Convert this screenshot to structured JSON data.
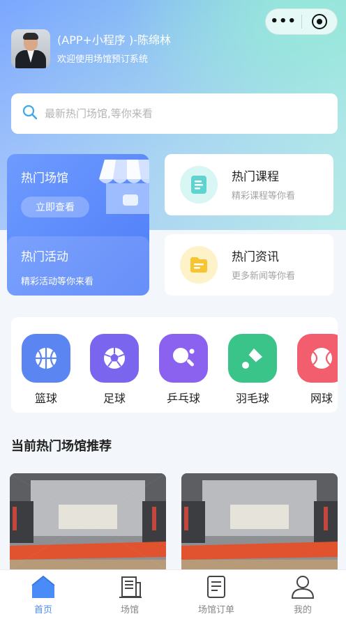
{
  "capsule": {
    "more_icon": "more-dots-icon",
    "close_icon": "target-circle-icon"
  },
  "profile": {
    "name": "(APP+小程序 )-陈绵林",
    "subtitle": "欢迎使用场馆预订系统"
  },
  "search": {
    "placeholder": "最新热门场馆,等你来看",
    "icon": "search-icon"
  },
  "venue_card": {
    "title": "热门场馆",
    "button_label": "立即查看",
    "activity_title": "热门活动",
    "activity_sub": "精彩活动等你来看"
  },
  "info_cards": [
    {
      "title": "热门课程",
      "sub": "精彩课程等你看",
      "icon": "document-icon"
    },
    {
      "title": "热门资讯",
      "sub": "更多新闻等你看",
      "icon": "folder-icon"
    }
  ],
  "sports": [
    {
      "label": "篮球",
      "icon": "basketball-icon",
      "color": "#5b86f2"
    },
    {
      "label": "足球",
      "icon": "football-icon",
      "color": "#7a66ee"
    },
    {
      "label": "乒乓球",
      "icon": "table-tennis-icon",
      "color": "#8b62ef"
    },
    {
      "label": "羽毛球",
      "icon": "badminton-icon",
      "color": "#3bc489"
    },
    {
      "label": "网球",
      "icon": "tennis-icon",
      "color": "#f25e6e"
    }
  ],
  "section": {
    "title": "当前热门场馆推荐"
  },
  "tabbar": [
    {
      "label": "首页",
      "icon": "home-icon",
      "active": true
    },
    {
      "label": "场馆",
      "icon": "venue-building-icon",
      "active": false
    },
    {
      "label": "场馆订单",
      "icon": "order-list-icon",
      "active": false
    },
    {
      "label": "我的",
      "icon": "user-icon",
      "active": false
    }
  ],
  "colors": {
    "accent": "#4a8cf7",
    "venue_card": "#5b88fa",
    "card_bg": "#ffffff"
  }
}
